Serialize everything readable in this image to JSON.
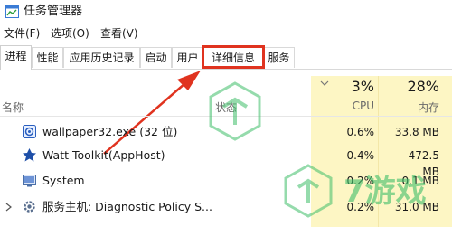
{
  "window": {
    "title": "任务管理器"
  },
  "menu": {
    "file": "文件(F)",
    "options": "选项(O)",
    "view": "查看(V)"
  },
  "tabs": [
    {
      "label": "进程"
    },
    {
      "label": "性能"
    },
    {
      "label": "应用历史记录"
    },
    {
      "label": "启动"
    },
    {
      "label": "用户"
    },
    {
      "label": "详细信息"
    },
    {
      "label": "服务"
    }
  ],
  "columns": {
    "name": "名称",
    "status": "状态",
    "cpu": {
      "percent": "3%",
      "label": "CPU"
    },
    "memory": {
      "percent": "28%",
      "label": "内存"
    }
  },
  "processes": [
    {
      "name": "wallpaper32.exe (32 位)",
      "cpu": "0.6%",
      "memory": "33.8 MB",
      "icon": "wallpaper-icon"
    },
    {
      "name": "Watt Toolkit(AppHost)",
      "cpu": "0.4%",
      "memory": "472.5 MB",
      "icon": "watt-toolkit-icon"
    },
    {
      "name": "System",
      "cpu": "0.2%",
      "memory": "0.1 MB",
      "icon": "system-icon"
    },
    {
      "name": "服务主机: Diagnostic Policy S...",
      "cpu": "0.2%",
      "memory": "31.0 MB",
      "icon": "gear-icon"
    }
  ],
  "watermark": {
    "text": "7游戏"
  },
  "colors": {
    "highlight": "#e0331f",
    "cpu_mem_shade": "#fdf6c4",
    "watermark": "#3fbf6a"
  }
}
